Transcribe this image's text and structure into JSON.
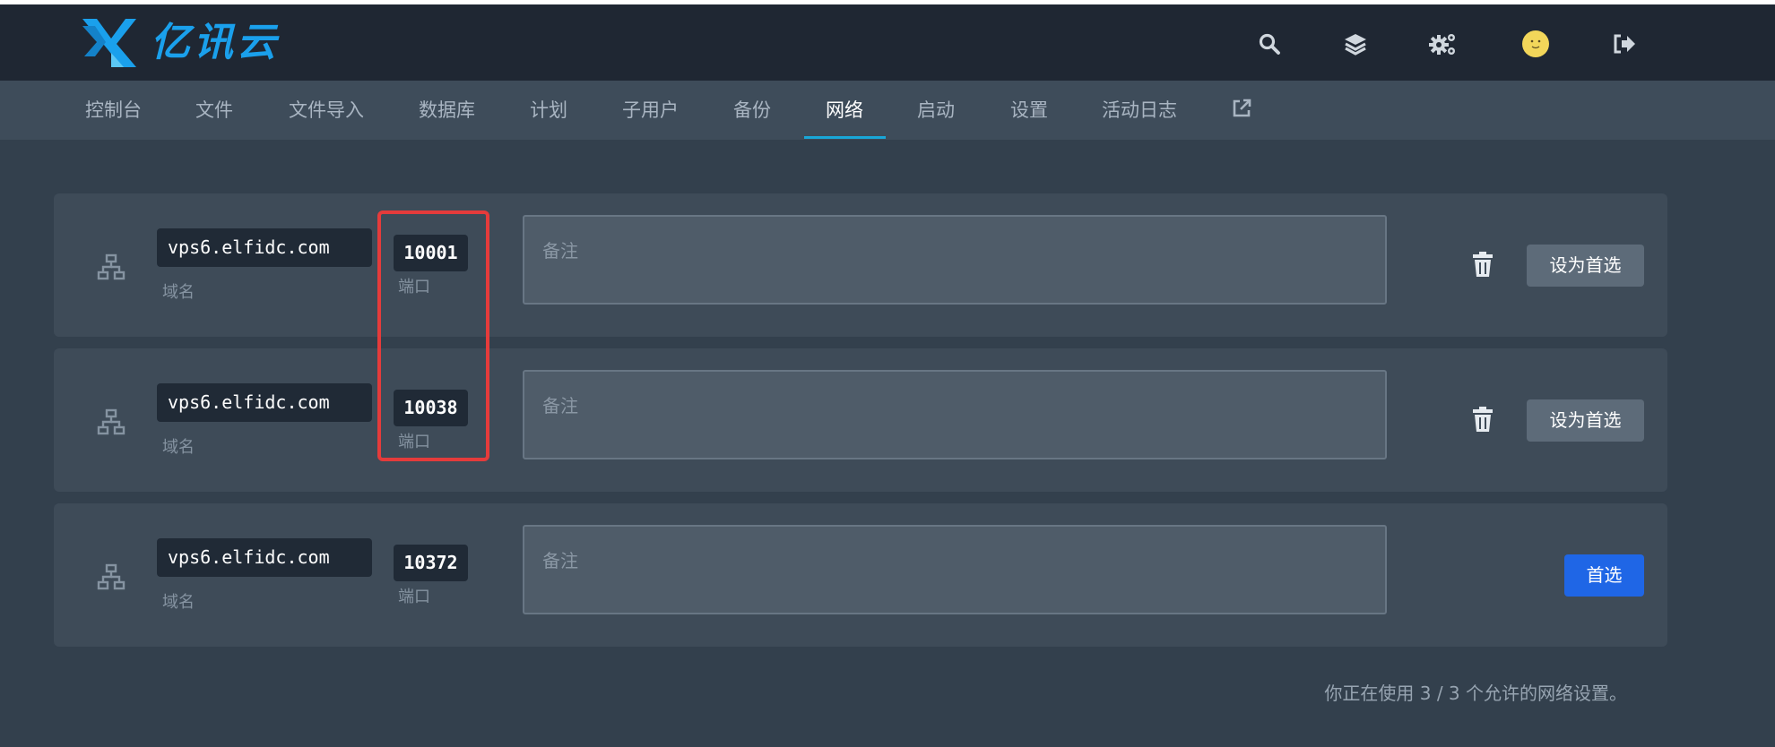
{
  "brand": {
    "name": "亿讯云"
  },
  "colors": {
    "accent": "#19a7d8",
    "primary_button": "#1f66e6",
    "highlight_box": "#e53b3b"
  },
  "header_icons": [
    "search-icon",
    "layers-icon",
    "settings-icon",
    "avatar",
    "logout-icon"
  ],
  "nav": {
    "items": [
      {
        "label": "控制台"
      },
      {
        "label": "文件"
      },
      {
        "label": "文件导入"
      },
      {
        "label": "数据库"
      },
      {
        "label": "计划"
      },
      {
        "label": "子用户"
      },
      {
        "label": "备份"
      },
      {
        "label": "网络"
      },
      {
        "label": "启动"
      },
      {
        "label": "设置"
      },
      {
        "label": "活动日志"
      }
    ],
    "active": "网络",
    "external_icon": "external-link-icon"
  },
  "allocations": [
    {
      "domain": "vps6.elfidc.com",
      "domain_label": "域名",
      "port": "10001",
      "port_label": "端口",
      "notes_placeholder": "备注",
      "action_label": "设为首选",
      "is_primary": false
    },
    {
      "domain": "vps6.elfidc.com",
      "domain_label": "域名",
      "port": "10038",
      "port_label": "端口",
      "notes_placeholder": "备注",
      "action_label": "设为首选",
      "is_primary": false
    },
    {
      "domain": "vps6.elfidc.com",
      "domain_label": "域名",
      "port": "10372",
      "port_label": "端口",
      "notes_placeholder": "备注",
      "action_label": "首选",
      "is_primary": true
    }
  ],
  "footer": {
    "usage_text": "你正在使用 3 / 3 个允许的网络设置。"
  }
}
